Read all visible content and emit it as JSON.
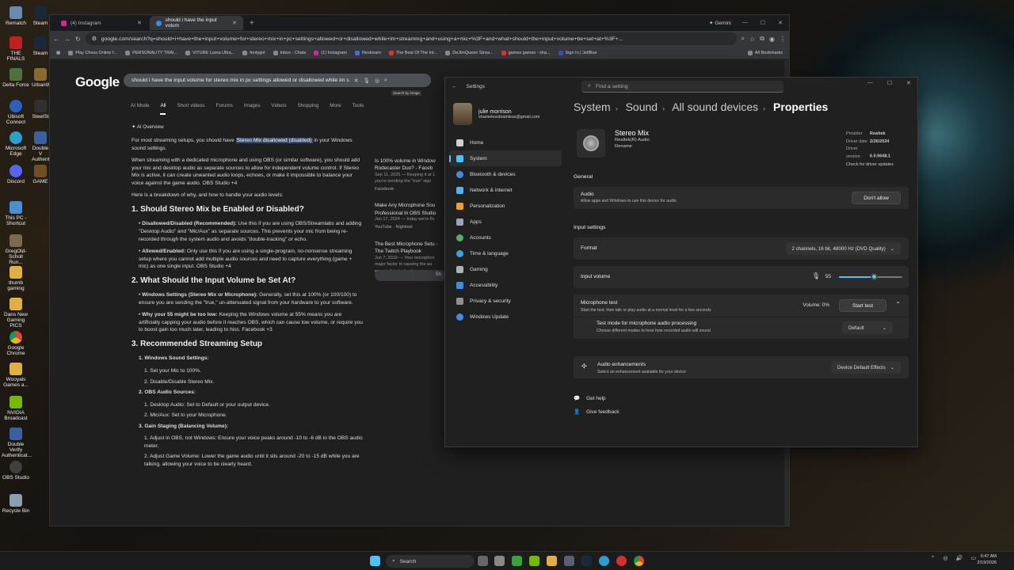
{
  "desktop": {
    "icons": [
      "Rematch",
      "Steam",
      "THE FINALS",
      "Steam",
      "Delta Force",
      "UrbanW",
      "Ubisoft Connect",
      "SteelSt",
      "Microsoft Edge",
      "Double V Authent",
      "Discord",
      "GAME",
      "This PC - Shortcut",
      "GregOld-Scholl Run...",
      "thumb gaming",
      "Dans New Gaming PICS",
      "Google Chrome",
      "Wooyals Games a...",
      "NVIDIA Broadcast",
      "Double Verify Authenticat...",
      "OBS Studio",
      "Recycle Bin"
    ]
  },
  "chrome": {
    "tabs": [
      {
        "label": "(4) Instagram"
      },
      {
        "label": "should i have the input volum"
      }
    ],
    "gemini": "Gemini",
    "url": "google.com/search?q=should+i+have+the+input+volume+for+stereo+mix+in+pc+settings+allowed+or+disallowed+while+im+streaming+and+using+a+mic+%3F+and+what+should+the+input+volume+be+set+at+%3F+...",
    "bookmarks": [
      "Play Chess Online f...",
      "PERSONALITY TRAI...",
      "VITURE Luma Ultra...",
      "fentygirl",
      "Inbox - Chats",
      "(1) Instagram",
      "Restream",
      "The Best Of The Int...",
      "DeJimQueen Strea...",
      "games games - sha...",
      "Sign In | JetBlue",
      "All Bookmarks"
    ]
  },
  "google": {
    "logo": "Google",
    "query": "should i have the input volume for stereo mix in pc settings allowed or disallowed while im s",
    "tooltip": "Search by image",
    "tabs": [
      "AI Mode",
      "All",
      "Short videos",
      "Forums",
      "Images",
      "Videos",
      "Shopping",
      "More",
      "Tools"
    ],
    "ai_label": "AI Overview",
    "p1a": "For most streaming setups, you should have ",
    "p1hl": "Stereo Mix disallowed (disabled)",
    "p1b": " in your Windows sound settings.",
    "p2": "When streaming with a dedicated microphone and using OBS (or similar software), you should add your mic and desktop audio as separate sources to allow for independent volume control. If Stereo Mix is active, it can create unwanted audio loops, echoes, or make it impossible to balance your voice against the game audio. OBS Studio +4",
    "p3": "Here is a breakdown of why, and how to handle your audio levels:",
    "h1": "1. Should Stereo Mix be Enabled or Disabled?",
    "b1t": "Disallowed/Disabled (Recommended):",
    "b1": " Use this if you are using OBS/Streamlabs and adding \"Desktop Audio\" and \"Mic/Aux\" as separate sources. This prevents your mic from being re-recorded through the system audio and avoids \"double-tracking\" or echo.",
    "b2t": "Allowed/Enabled:",
    "b2": " Only use this if you are using a single-program, no-nonsense streaming setup where you cannot add multiple audio sources and need to capture everything (game + mic) as one single input. OBS Studio +4",
    "h2": "2. What Should the Input Volume be Set At?",
    "b3t": "Windows Settings (Stereo Mix or Microphone):",
    "b3": " Generally, set this at 100% (or 100/100) to ensure you are sending the \"true,\" un-attenuated signal from your hardware to your software.",
    "b4t": "Why your 55 might be too low:",
    "b4": " Keeping the Windows volume at 55% means you are artificially capping your audio before it reaches OBS, which can cause low volume, or require you to boost gain too much later, leading to hiss. Facebook +3",
    "h3": "3. Recommended Streaming Setup",
    "s1": "1. Windows Sound Settings:",
    "s1a": "1. Set your Mic to 100%.",
    "s1b": "2. Disable/Disable Stereo Mix.",
    "s2": "2. OBS Audio Sources:",
    "s2a": "1. Desktop Audio: Set to Default or your output device.",
    "s2b": "2. Mic/Aux: Set to your Microphone.",
    "s3": "3. Gain Staging (Balancing Volume):",
    "s3a": "1. Adjust in OBS, not Windows: Ensure your voice peaks around -10 to -6 dB in the OBS audio meter.",
    "s3b": "2. Adjust Game Volume: Lower the game audio until it sits around -20 to -15 dB while you are talking, allowing your voice to be clearly heard.",
    "cards": [
      {
        "title": "Is 100% volume in Window Rodecaster Duo? - Faceb",
        "meta": "Sep 11, 2025 — Keeping it at 1 you're sending the \"true\" sign",
        "src": "Facebook"
      },
      {
        "title": "Make Any Microphone Sou Professional In OBS Studio",
        "meta": "Jan 17, 2024 — today we're fix",
        "src": "YouTube · Nightowl"
      },
      {
        "title": "The Best Microphone Setu - The Twitch Playbook",
        "meta": "Jun 7, 2019 — Your microphon major factor in causing the au",
        "src": "www.twitchplaybook.com"
      }
    ],
    "show_all": "Sh"
  },
  "settings": {
    "title": "Settings",
    "search_placeholder": "Find a setting",
    "user_name": "julie morrison",
    "user_email": "shamelessbrainless@gmail.com",
    "nav": [
      {
        "label": "Home",
        "color": "#d0d0d0"
      },
      {
        "label": "System",
        "color": "#4cc2ff"
      },
      {
        "label": "Bluetooth & devices",
        "color": "#3a8ee6"
      },
      {
        "label": "Network & internet",
        "color": "#5ab0e8"
      },
      {
        "label": "Personalization",
        "color": "#e8a030"
      },
      {
        "label": "Apps",
        "color": "#a0a0c0"
      },
      {
        "label": "Accounts",
        "color": "#4fb06a"
      },
      {
        "label": "Time & language",
        "color": "#3aa0e0"
      },
      {
        "label": "Gaming",
        "color": "#b0b0b0"
      },
      {
        "label": "Accessibility",
        "color": "#3a90e0"
      },
      {
        "label": "Privacy & security",
        "color": "#909090"
      },
      {
        "label": "Windows Update",
        "color": "#3a8ee6"
      }
    ],
    "crumbs": [
      "System",
      "Sound",
      "All sound devices",
      "Properties"
    ],
    "device_name": "Stereo Mix",
    "device_sub": "Realtek(R) Audio",
    "rename": "Rename",
    "provider_label": "Provider",
    "provider": "Realtek",
    "driver_date_label": "Driver date",
    "driver_date": "2/26/2024",
    "driver_version_label": "Driver version",
    "driver_version": "6.0.9648.1",
    "check_updates": "Check for driver updates",
    "general": "General",
    "audio_label": "Audio",
    "audio_desc": "Allow apps and Windows to use this device for audio",
    "dont_allow": "Don't allow",
    "input_settings": "Input settings",
    "format_label": "Format",
    "format_value": "2 channels, 16 bit, 48000 Hz (DVD Quality)",
    "input_volume_label": "Input volume",
    "input_volume": "55",
    "input_volume_fraction": 0.55,
    "mic_test_label": "Microphone test",
    "mic_test_desc": "Start the test, then talk or play audio at a normal level for a few seconds",
    "volume_readout": "Volume: 0%",
    "start_test": "Start test",
    "test_mode_label": "Test mode for microphone audio processing",
    "test_mode_desc": "Choose different modes to hear how recorded audio will sound",
    "test_mode_value": "Default",
    "enh_label": "Audio enhancements",
    "enh_desc": "Select an enhancement available for your device",
    "enh_value": "Device Default Effects",
    "get_help": "Get help",
    "give_feedback": "Give feedback"
  },
  "taskbar": {
    "search": "Search",
    "time": "6:47 AM",
    "date": "2/19/2026"
  }
}
